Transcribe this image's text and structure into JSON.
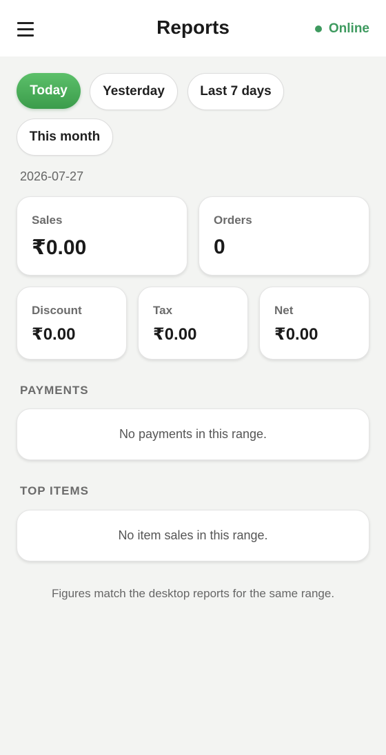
{
  "header": {
    "title": "Reports",
    "status_label": "Online",
    "status_color": "#3e9a5f",
    "menu_icon": "hamburger-menu-icon"
  },
  "range_filters": [
    {
      "label": "Today",
      "selected": true
    },
    {
      "label": "Yesterday",
      "selected": false
    },
    {
      "label": "Last 7 days",
      "selected": false
    },
    {
      "label": "This month",
      "selected": false
    }
  ],
  "date": "2026-07-27",
  "summary": {
    "sales": {
      "label": "Sales",
      "value": "₹0.00"
    },
    "orders": {
      "label": "Orders",
      "value": "0"
    },
    "discount": {
      "label": "Discount",
      "value": "₹0.00"
    },
    "tax": {
      "label": "Tax",
      "value": "₹0.00"
    },
    "net": {
      "label": "Net",
      "value": "₹0.00"
    }
  },
  "payments": {
    "title": "PAYMENTS",
    "empty_text": "No payments in this range."
  },
  "top_items": {
    "title": "TOP ITEMS",
    "empty_text": "No item sales in this range."
  },
  "footnote": "Figures match the desktop reports for the same range.",
  "colors": {
    "accent": "#4caf5c",
    "background": "#f3f4f2"
  }
}
